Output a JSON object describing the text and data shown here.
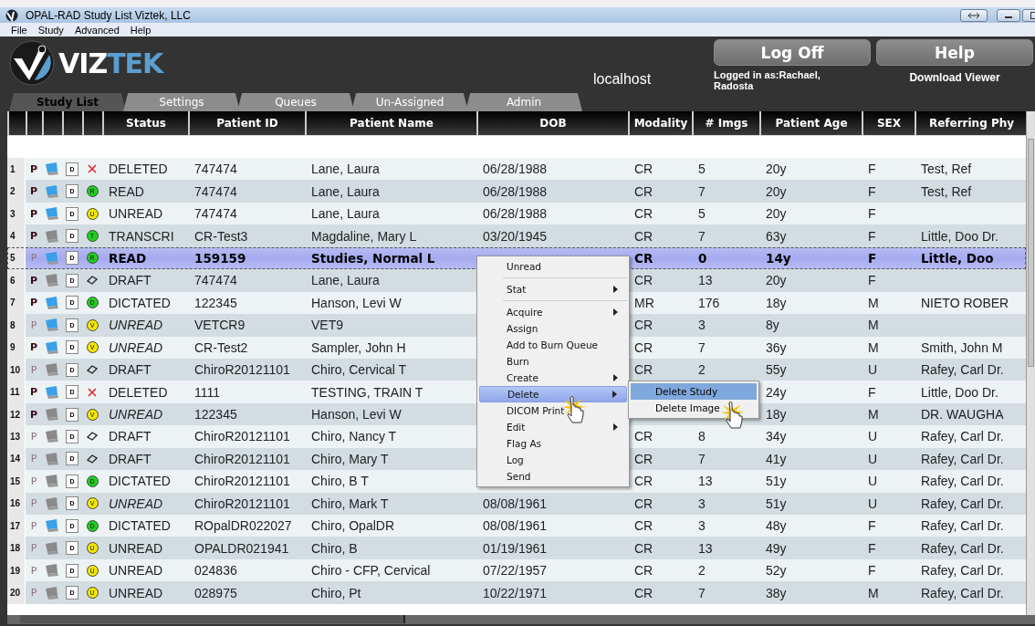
{
  "window": {
    "title": "OPAL-RAD Study List Viztek, LLC"
  },
  "menu_bar": [
    "File",
    "Study",
    "Advanced",
    "Help"
  ],
  "header": {
    "logo_text": "VIZ",
    "logo_text_accent": "TEK",
    "host": "localhost",
    "log_off": "Log Off",
    "help": "Help",
    "logged_in": "Logged in as:Rachael, Radosta",
    "download": "Download Viewer"
  },
  "tabs": [
    {
      "label": "Study List",
      "selected": true
    },
    {
      "label": "Settings",
      "selected": false
    },
    {
      "label": "Queues",
      "selected": false
    },
    {
      "label": "Un-Assigned",
      "selected": false
    },
    {
      "label": "Admin",
      "selected": false
    }
  ],
  "table": {
    "columns": [
      "Status",
      "Patient ID",
      "Patient Name",
      "DOB",
      "Modality",
      "# Imgs",
      "Patient Age",
      "SEX",
      "Referring Phy"
    ],
    "rows": [
      {
        "n": "1",
        "p": "P",
        "p_on": true,
        "monitor_on": true,
        "doc": "D",
        "icon": {
          "kind": "cross"
        },
        "italic": false,
        "selected": false,
        "cells": [
          "DELETED",
          "747474",
          "Lane, Laura",
          "06/28/1988",
          "CR",
          "5",
          "20y",
          "F",
          "Test, Ref"
        ]
      },
      {
        "n": "2",
        "p": "P",
        "p_on": true,
        "monitor_on": true,
        "doc": "D",
        "icon": {
          "kind": "circle",
          "letter": "R",
          "color": "#22cc22"
        },
        "italic": false,
        "selected": false,
        "cells": [
          "READ",
          "747474",
          "Lane, Laura",
          "06/28/1988",
          "CR",
          "7",
          "20y",
          "F",
          "Test, Ref"
        ]
      },
      {
        "n": "3",
        "p": "P",
        "p_on": true,
        "monitor_on": true,
        "doc": "D",
        "icon": {
          "kind": "circle",
          "letter": "U",
          "color": "#f2e600"
        },
        "italic": false,
        "selected": false,
        "cells": [
          "UNREAD",
          "747474",
          "Lane, Laura",
          "06/28/1988",
          "CR",
          "5",
          "20y",
          "F",
          ""
        ]
      },
      {
        "n": "4",
        "p": "P",
        "p_on": true,
        "monitor_on": false,
        "doc": "D",
        "icon": {
          "kind": "circle",
          "letter": "T",
          "color": "#22cc22"
        },
        "italic": false,
        "selected": false,
        "cells": [
          "TRANSCRI",
          "CR-Test3",
          "Magdaline, Mary L",
          "03/20/1945",
          "CR",
          "7",
          "63y",
          "F",
          "Little, Doo Dr."
        ]
      },
      {
        "n": "5",
        "p": "P",
        "p_on": false,
        "monitor_on": true,
        "doc": "D",
        "icon": {
          "kind": "circle",
          "letter": "R",
          "color": "#22cc22"
        },
        "italic": false,
        "selected": true,
        "cells": [
          "READ",
          "159159",
          "Studies, Normal L",
          "",
          "CR",
          "0",
          "14y",
          "F",
          "Little, Doo"
        ]
      },
      {
        "n": "6",
        "p": "P",
        "p_on": true,
        "monitor_on": false,
        "doc": "D",
        "icon": {
          "kind": "eraser"
        },
        "italic": false,
        "selected": false,
        "cells": [
          "DRAFT",
          "747474",
          "Lane, Laura",
          "",
          "CR",
          "13",
          "20y",
          "F",
          ""
        ]
      },
      {
        "n": "7",
        "p": "P",
        "p_on": true,
        "monitor_on": true,
        "doc": "D",
        "icon": {
          "kind": "circle",
          "letter": "D",
          "color": "#22cc22"
        },
        "italic": false,
        "selected": false,
        "cells": [
          "DICTATED",
          "122345",
          "Hanson, Levi W",
          "",
          "MR",
          "176",
          "18y",
          "M",
          "NIETO ROBER"
        ]
      },
      {
        "n": "8",
        "p": "P",
        "p_on": false,
        "monitor_on": true,
        "doc": "D",
        "icon": {
          "kind": "circle",
          "letter": "V",
          "color": "#f2e600"
        },
        "italic": true,
        "selected": false,
        "cells": [
          "UNREAD",
          "VETCR9",
          "VET9",
          "",
          "CR",
          "3",
          "8y",
          "M",
          ""
        ]
      },
      {
        "n": "9",
        "p": "P",
        "p_on": true,
        "monitor_on": true,
        "doc": "D",
        "icon": {
          "kind": "circle",
          "letter": "V",
          "color": "#f2e600"
        },
        "italic": true,
        "selected": false,
        "cells": [
          "UNREAD",
          "CR-Test2",
          "Sampler, John H",
          "",
          "CR",
          "7",
          "36y",
          "M",
          "Smith, John M"
        ]
      },
      {
        "n": "10",
        "p": "P",
        "p_on": false,
        "monitor_on": false,
        "doc": "D",
        "icon": {
          "kind": "eraser"
        },
        "italic": false,
        "selected": false,
        "cells": [
          "DRAFT",
          "ChiroR20121101",
          "Chiro, Cervical T",
          "",
          "CR",
          "2",
          "55y",
          "U",
          "Rafey, Carl Dr."
        ]
      },
      {
        "n": "11",
        "p": "P",
        "p_on": true,
        "monitor_on": true,
        "doc": "D",
        "icon": {
          "kind": "cross"
        },
        "italic": false,
        "selected": false,
        "cells": [
          "DELETED",
          "1111",
          "TESTING, TRAIN T",
          "",
          "",
          "",
          "24y",
          "F",
          "Little, Doo Dr."
        ]
      },
      {
        "n": "12",
        "p": "P",
        "p_on": true,
        "monitor_on": false,
        "doc": "D",
        "icon": {
          "kind": "circle",
          "letter": "V",
          "color": "#f2e600"
        },
        "italic": true,
        "selected": false,
        "cells": [
          "UNREAD",
          "122345",
          "Hanson, Levi W",
          "",
          "",
          "",
          "18y",
          "M",
          "DR. WAUGHA"
        ]
      },
      {
        "n": "13",
        "p": "P",
        "p_on": false,
        "monitor_on": false,
        "doc": "D",
        "icon": {
          "kind": "eraser"
        },
        "italic": false,
        "selected": false,
        "cells": [
          "DRAFT",
          "ChiroR20121101",
          "Chiro, Nancy T",
          "",
          "CR",
          "8",
          "34y",
          "U",
          "Rafey, Carl Dr."
        ]
      },
      {
        "n": "14",
        "p": "P",
        "p_on": false,
        "monitor_on": false,
        "doc": "D",
        "icon": {
          "kind": "eraser"
        },
        "italic": false,
        "selected": false,
        "cells": [
          "DRAFT",
          "ChiroR20121101",
          "Chiro, Mary T",
          "",
          "CR",
          "7",
          "41y",
          "U",
          "Rafey, Carl Dr."
        ]
      },
      {
        "n": "15",
        "p": "P",
        "p_on": false,
        "monitor_on": false,
        "doc": "D",
        "icon": {
          "kind": "circle",
          "letter": "D",
          "color": "#22cc22"
        },
        "italic": false,
        "selected": false,
        "cells": [
          "DICTATED",
          "ChiroR20121101",
          "Chiro, B T",
          "",
          "CR",
          "13",
          "51y",
          "U",
          "Rafey, Carl Dr."
        ]
      },
      {
        "n": "16",
        "p": "P",
        "p_on": false,
        "monitor_on": false,
        "doc": "D",
        "icon": {
          "kind": "circle",
          "letter": "V",
          "color": "#f2e600"
        },
        "italic": true,
        "selected": false,
        "cells": [
          "UNREAD",
          "ChiroR20121101",
          "Chiro, Mark T",
          "08/08/1961",
          "CR",
          "3",
          "51y",
          "U",
          "Rafey, Carl Dr."
        ]
      },
      {
        "n": "17",
        "p": "P",
        "p_on": false,
        "monitor_on": true,
        "doc": "D",
        "icon": {
          "kind": "circle",
          "letter": "D",
          "color": "#22cc22"
        },
        "italic": false,
        "selected": false,
        "cells": [
          "DICTATED",
          "ROpalDR022027",
          "Chiro, OpalDR",
          "08/08/1961",
          "CR",
          "3",
          "48y",
          "F",
          "Rafey, Carl Dr."
        ]
      },
      {
        "n": "18",
        "p": "P",
        "p_on": false,
        "monitor_on": false,
        "doc": "D",
        "icon": {
          "kind": "circle",
          "letter": "U",
          "color": "#f2e600"
        },
        "italic": false,
        "selected": false,
        "cells": [
          "UNREAD",
          "OPALDR021941",
          "Chiro, B",
          "01/19/1961",
          "CR",
          "13",
          "49y",
          "F",
          "Rafey, Carl Dr."
        ]
      },
      {
        "n": "19",
        "p": "P",
        "p_on": false,
        "monitor_on": false,
        "doc": "D",
        "icon": {
          "kind": "circle",
          "letter": "U",
          "color": "#f2e600"
        },
        "italic": false,
        "selected": false,
        "cells": [
          "UNREAD",
          "024836",
          "Chiro - CFP, Cervical",
          "07/22/1957",
          "CR",
          "2",
          "52y",
          "F",
          "Rafey, Carl Dr."
        ]
      },
      {
        "n": "20",
        "p": "P",
        "p_on": false,
        "monitor_on": false,
        "doc": "D",
        "icon": {
          "kind": "circle",
          "letter": "U",
          "color": "#f2e600"
        },
        "italic": false,
        "selected": false,
        "cells": [
          "UNREAD",
          "028975",
          "Chiro, Pt",
          "10/22/1971",
          "CR",
          "7",
          "38y",
          "M",
          "Rafey, Carl Dr."
        ]
      }
    ]
  },
  "context_menu": {
    "items": [
      {
        "kind": "item",
        "label": "Unread",
        "submenu": false,
        "selected": false
      },
      {
        "kind": "separator"
      },
      {
        "kind": "item",
        "label": "Stat",
        "submenu": true,
        "selected": false
      },
      {
        "kind": "separator"
      },
      {
        "kind": "item",
        "label": "Acquire",
        "submenu": true,
        "selected": false
      },
      {
        "kind": "item",
        "label": "Assign",
        "submenu": false,
        "selected": false
      },
      {
        "kind": "item",
        "label": "Add to Burn Queue",
        "submenu": false,
        "selected": false
      },
      {
        "kind": "item",
        "label": "Burn",
        "submenu": false,
        "selected": false
      },
      {
        "kind": "item",
        "label": "Create",
        "submenu": true,
        "selected": false
      },
      {
        "kind": "item",
        "label": "Delete",
        "submenu": true,
        "selected": true
      },
      {
        "kind": "item",
        "label": "DICOM Print",
        "submenu": false,
        "selected": false
      },
      {
        "kind": "item",
        "label": "Edit",
        "submenu": true,
        "selected": false
      },
      {
        "kind": "item",
        "label": "Flag As",
        "submenu": false,
        "selected": false
      },
      {
        "kind": "item",
        "label": "Log",
        "submenu": false,
        "selected": false
      },
      {
        "kind": "item",
        "label": "Send",
        "submenu": false,
        "selected": false
      }
    ],
    "submenu": [
      {
        "label": "Delete Study",
        "selected": true
      },
      {
        "label": "Delete Image",
        "selected": false
      }
    ]
  }
}
